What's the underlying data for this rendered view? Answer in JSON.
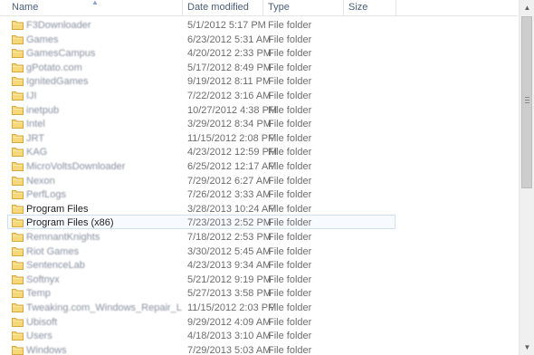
{
  "columns": {
    "name": "Name",
    "date_modified": "Date modified",
    "type": "Type",
    "size": "Size"
  },
  "sort": {
    "column": "Name",
    "direction": "ascending"
  },
  "scrollbar": {
    "position": 0.0
  },
  "files": [
    {
      "name": "F3Downloader",
      "date": "5/1/2012 5:17 PM",
      "type": "File folder",
      "blurred": true
    },
    {
      "name": "Games",
      "date": "6/23/2012 5:31 AM",
      "type": "File folder",
      "blurred": true
    },
    {
      "name": "GamesCampus",
      "date": "4/20/2012 2:33 PM",
      "type": "File folder",
      "blurred": true
    },
    {
      "name": "gPotato.com",
      "date": "5/17/2012 8:49 PM",
      "type": "File folder",
      "blurred": true
    },
    {
      "name": "IgnitedGames",
      "date": "9/19/2012 8:11 PM",
      "type": "File folder",
      "blurred": true
    },
    {
      "name": "IJI",
      "date": "7/22/2012 3:16 AM",
      "type": "File folder",
      "blurred": true
    },
    {
      "name": "inetpub",
      "date": "10/27/2012 4:38 PM",
      "type": "File folder",
      "blurred": true
    },
    {
      "name": "Intel",
      "date": "3/29/2012 8:34 PM",
      "type": "File folder",
      "blurred": true
    },
    {
      "name": "JRT",
      "date": "11/15/2012 2:08 PM",
      "type": "File folder",
      "blurred": true
    },
    {
      "name": "KAG",
      "date": "4/23/2012 12:59 PM",
      "type": "File folder",
      "blurred": true
    },
    {
      "name": "MicroVoltsDownloader",
      "date": "6/25/2012 12:17 AM",
      "type": "File folder",
      "blurred": true
    },
    {
      "name": "Nexon",
      "date": "7/29/2012 6:27 AM",
      "type": "File folder",
      "blurred": true
    },
    {
      "name": "PerfLogs",
      "date": "7/26/2012 3:33 AM",
      "type": "File folder",
      "blurred": true
    },
    {
      "name": "Program Files",
      "date": "3/28/2013 10:24 AM",
      "type": "File folder",
      "blurred": false
    },
    {
      "name": "Program Files (x86)",
      "date": "7/23/2013 2:52 PM",
      "type": "File folder",
      "blurred": false,
      "selected": true
    },
    {
      "name": "RemnantKnights",
      "date": "7/18/2012 2:53 PM",
      "type": "File folder",
      "blurred": true
    },
    {
      "name": "Riot Games",
      "date": "3/30/2012 5:45 AM",
      "type": "File folder",
      "blurred": true
    },
    {
      "name": "SentenceLab",
      "date": "4/23/2013 9:34 AM",
      "type": "File folder",
      "blurred": true
    },
    {
      "name": "Softnyx",
      "date": "5/21/2012 9:19 PM",
      "type": "File folder",
      "blurred": true
    },
    {
      "name": "Temp",
      "date": "5/27/2013 3:58 PM",
      "type": "File folder",
      "blurred": true
    },
    {
      "name": "Tweaking.com_Windows_Repair_Logs",
      "date": "11/15/2012 2:03 PM",
      "type": "File folder",
      "blurred": true
    },
    {
      "name": "Ubisoft",
      "date": "9/29/2012 4:09 AM",
      "type": "File folder",
      "blurred": true
    },
    {
      "name": "Users",
      "date": "4/18/2013 3:10 AM",
      "type": "File folder",
      "blurred": true
    },
    {
      "name": "Windows",
      "date": "7/29/2013 5:03 AM",
      "type": "File folder",
      "blurred": true
    }
  ],
  "icons": {
    "folder": "folder-icon",
    "sort": "sort-up-arrow-icon",
    "scroll_up": "scroll-up-arrow-icon",
    "scroll_down": "scroll-down-arrow-icon"
  },
  "colors": {
    "header_text": "#4c607a",
    "folder_fill": "#f6d77a",
    "folder_edge": "#d7a93a",
    "selection_border": "#cfe0f3",
    "selection_fill": "#f7fbff"
  }
}
